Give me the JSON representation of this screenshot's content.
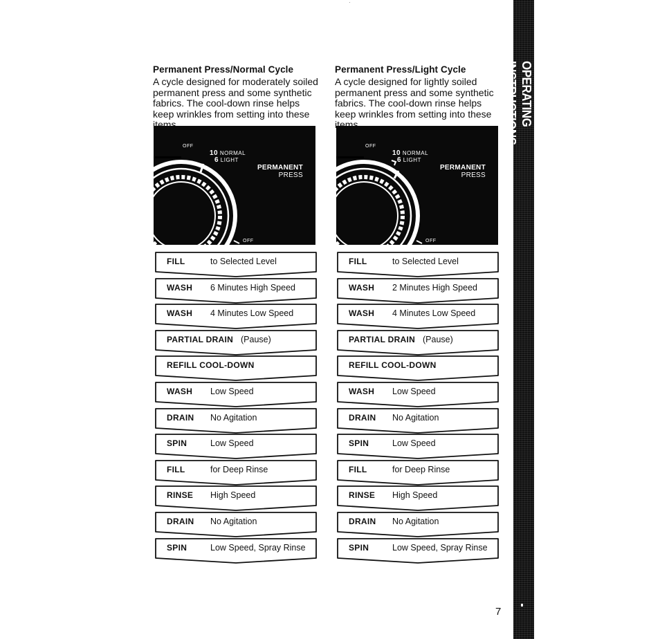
{
  "sidebar_tab": {
    "label": "OPERATING INSTRUCTIONS"
  },
  "page_number": "7",
  "cycles": [
    {
      "title": "Permanent Press/Normal Cycle",
      "description": "A cycle designed for moderately soiled permanent press and some synthetic fabrics. The cool-down rinse helps keep wrinkles from setting into these items.",
      "dial": {
        "off_top": "OFF",
        "normal_num": "10",
        "normal_label": "NORMAL",
        "light_num": "6",
        "light_label": "LIGHT",
        "setting_line1": "PERMANENT",
        "setting_line2": "PRESS",
        "off_bottom": "OFF"
      },
      "steps": [
        {
          "action": "FILL",
          "detail": "to Selected Level"
        },
        {
          "action": "WASH",
          "detail": "6 Minutes High Speed"
        },
        {
          "action": "WASH",
          "detail": "4 Minutes Low Speed"
        },
        {
          "action": "PARTIAL DRAIN",
          "detail": "(Pause)"
        },
        {
          "action": "REFILL COOL-DOWN",
          "detail": ""
        },
        {
          "action": "WASH",
          "detail": "Low Speed"
        },
        {
          "action": "DRAIN",
          "detail": "No Agitation"
        },
        {
          "action": "SPIN",
          "detail": "Low Speed"
        },
        {
          "action": "FILL",
          "detail": "for Deep Rinse"
        },
        {
          "action": "RINSE",
          "detail": "High Speed"
        },
        {
          "action": "DRAIN",
          "detail": "No Agitation"
        },
        {
          "action": "SPIN",
          "detail": "Low Speed, Spray Rinse"
        }
      ]
    },
    {
      "title": "Permanent Press/Light Cycle",
      "description": "A cycle designed for lightly soiled permanent press and some synthetic fabrics. The cool-down rinse helps keep wrinkles from setting into these items.",
      "dial": {
        "off_top": "OFF",
        "normal_num": "10",
        "normal_label": "NORMAL",
        "light_num": "6",
        "light_label": "LIGHT",
        "setting_line1": "PERMANENT",
        "setting_line2": "PRESS",
        "off_bottom": "OFF"
      },
      "steps": [
        {
          "action": "FILL",
          "detail": "to Selected Level"
        },
        {
          "action": "WASH",
          "detail": "2 Minutes High Speed"
        },
        {
          "action": "WASH",
          "detail": "4 Minutes Low Speed"
        },
        {
          "action": "PARTIAL DRAIN",
          "detail": "(Pause)"
        },
        {
          "action": "REFILL COOL-DOWN",
          "detail": ""
        },
        {
          "action": "WASH",
          "detail": "Low Speed"
        },
        {
          "action": "DRAIN",
          "detail": "No Agitation"
        },
        {
          "action": "SPIN",
          "detail": "Low Speed"
        },
        {
          "action": "FILL",
          "detail": "for Deep Rinse"
        },
        {
          "action": "RINSE",
          "detail": "High Speed"
        },
        {
          "action": "DRAIN",
          "detail": "No Agitation"
        },
        {
          "action": "SPIN",
          "detail": "Low Speed, Spray Rinse"
        }
      ]
    }
  ]
}
